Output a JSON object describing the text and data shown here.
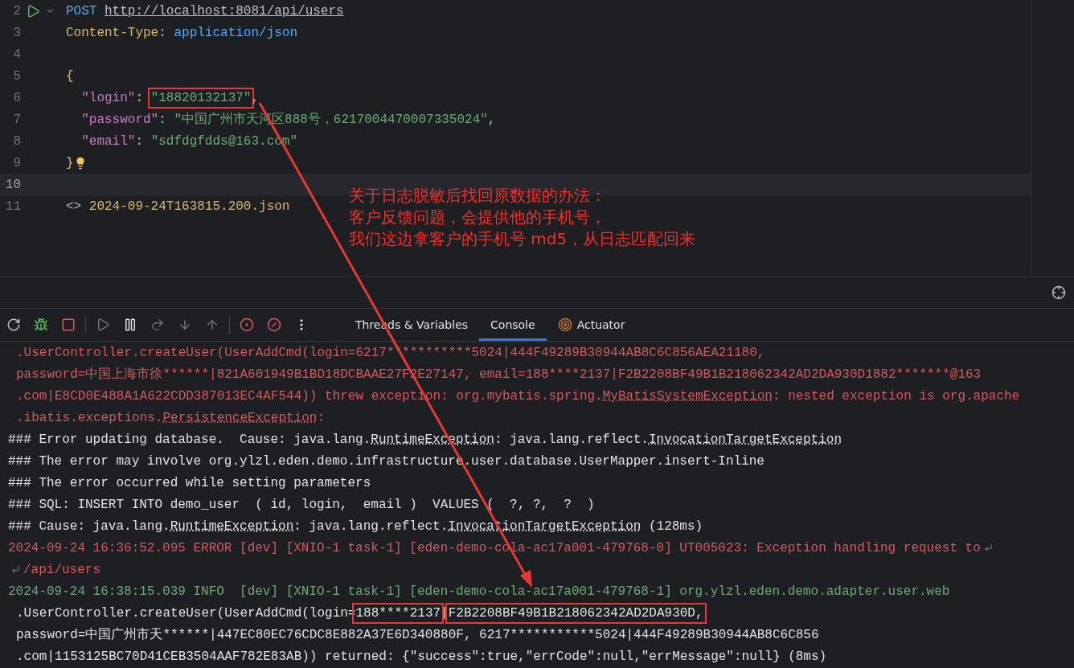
{
  "editor": {
    "lines": [
      {
        "number": "2",
        "runnable": true,
        "segments": [
          {
            "text": "POST ",
            "kind": "keyword"
          },
          {
            "text": "http://localhost:8081/api/users",
            "kind": "url"
          }
        ]
      },
      {
        "number": "3",
        "segments": [
          {
            "text": "Content-Type",
            "kind": "header"
          },
          {
            "text": ": ",
            "kind": "punct"
          },
          {
            "text": "application/json",
            "kind": "keyword"
          }
        ]
      },
      {
        "number": "4"
      },
      {
        "number": "5",
        "segments": [
          {
            "text": "{",
            "kind": "brace"
          }
        ]
      },
      {
        "number": "6",
        "segments": [
          {
            "text": "  \"login\"",
            "kind": "key"
          },
          {
            "text": ": ",
            "kind": "punct"
          },
          {
            "text": "\"18820132137\"",
            "kind": "string",
            "highlight": true
          },
          {
            "text": ",",
            "kind": "punct"
          }
        ]
      },
      {
        "number": "7",
        "segments": [
          {
            "text": "  \"password\"",
            "kind": "key"
          },
          {
            "text": ": ",
            "kind": "punct"
          },
          {
            "text": "\"中国广州市天河区888号，6217004470007335024\"",
            "kind": "string"
          },
          {
            "text": ",",
            "kind": "punct"
          }
        ]
      },
      {
        "number": "8",
        "segments": [
          {
            "text": "  \"email\"",
            "kind": "key"
          },
          {
            "text": ": ",
            "kind": "punct"
          },
          {
            "text": "\"sdfdgfdds@163.com\"",
            "kind": "string"
          }
        ]
      },
      {
        "number": "9",
        "hint": true,
        "segments": [
          {
            "text": "}",
            "kind": "brace"
          }
        ]
      },
      {
        "number": "10",
        "current": true
      },
      {
        "number": "11",
        "segments": [
          {
            "text": "<>",
            "kind": "punct"
          },
          {
            "text": " 2024-09-24T163815.200.json",
            "kind": "header"
          }
        ]
      }
    ]
  },
  "annotation": {
    "lines": [
      "关于日志脱敏后找回原数据的办法：",
      "客户反馈问题，会提供他的手机号，",
      "我们这边拿客户的手机号 md5，从日志匹配回来"
    ]
  },
  "debugger": {
    "tabs": [
      {
        "label": "Threads & Variables",
        "selected": false
      },
      {
        "label": "Console",
        "selected": true
      },
      {
        "label": "Actuator",
        "selected": false
      }
    ]
  },
  "console": {
    "lines": [
      {
        "kind": "error",
        "continued": true,
        "segments": [
          {
            "text": ".UserController.createUser(UserAddCmd(login=6217***********5024|444F49289B30944AB8C6C856AEA21180,"
          }
        ]
      },
      {
        "kind": "error",
        "continued": true,
        "segments": [
          {
            "text": "password=中国上海市徐******|821A601949B1BD18DCBAAE27F2E27147, email=188****2137|F2B2208BF49B1B218062342AD2DA930D1882*******@163"
          }
        ]
      },
      {
        "kind": "error",
        "continued": true,
        "segments": [
          {
            "text": ".com|E8CD0E488A1A622CDD387013EC4AF544)) threw exception: org.mybatis.spring."
          },
          {
            "text": "MyBatisSystemException",
            "link": true
          },
          {
            "text": ": nested exception is org.apache"
          }
        ]
      },
      {
        "kind": "error",
        "continued": true,
        "segments": [
          {
            "text": ".ibatis.exceptions."
          },
          {
            "text": "PersistenceException",
            "link": true
          },
          {
            "text": ":"
          }
        ]
      },
      {
        "kind": "plain",
        "segments": [
          {
            "text": "### Error updating database.  Cause: java.lang."
          },
          {
            "text": "RuntimeException",
            "link": true
          },
          {
            "text": ": java.lang.reflect."
          },
          {
            "text": "InvocationTargetException",
            "link": true
          }
        ]
      },
      {
        "kind": "plain",
        "segments": [
          {
            "text": "### The error may involve org.ylzl.eden.demo.infrastructure.user.database.UserMapper.insert-Inline"
          }
        ]
      },
      {
        "kind": "plain",
        "segments": [
          {
            "text": "### The error occurred while setting parameters"
          }
        ]
      },
      {
        "kind": "plain",
        "segments": [
          {
            "text": "### SQL: INSERT INTO demo_user  ( id, login,  email )  VALUES (  ?, ?,  ?  )"
          }
        ]
      },
      {
        "kind": "plain",
        "segments": [
          {
            "text": "### Cause: java.lang."
          },
          {
            "text": "RuntimeException",
            "link": true
          },
          {
            "text": ": java.lang.reflect."
          },
          {
            "text": "InvocationTargetException",
            "link": true
          },
          {
            "text": " (128ms)"
          }
        ]
      },
      {
        "kind": "error",
        "wrap_end": true,
        "segments": [
          {
            "text": "2024-09-24 16:36:52.095 ERROR [dev] [XNIO-1 task-1] [eden-demo-cola-ac17a001-479768-0] UT005023: Exception handling request to"
          }
        ]
      },
      {
        "kind": "error",
        "wrap_start": true,
        "segments": [
          {
            "text": "/api/users"
          }
        ]
      },
      {
        "kind": "info",
        "segments": [
          {
            "text": "2024-09-24 16:38:15.039 INFO  [dev] [XNIO-1 task-1] [eden-demo-cola-ac17a001-479768-1] org.ylzl.eden.demo.adapter.user.web"
          }
        ]
      },
      {
        "kind": "plain",
        "continued": true,
        "segments": [
          {
            "text": ".UserController.createUser(UserAddCmd(login="
          },
          {
            "text": "188****2137",
            "highlight": true
          },
          {
            "text": "|"
          },
          {
            "text": "F2B2208BF49B1B218062342AD2DA930D,",
            "highlight": true
          }
        ]
      },
      {
        "kind": "plain",
        "continued": true,
        "segments": [
          {
            "text": "password=中国广州市天******|447EC80EC76CDC8E882A37E6D340880F, 6217***********5024|444F49289B30944AB8C6C856"
          }
        ]
      },
      {
        "kind": "plain",
        "continued": true,
        "segments": [
          {
            "text": ".com|1153125BC70D41CEB3504AAF782E83AB)) returned: {\"success\":true,\"errCode\":null,\"errMessage\":null} (8ms)"
          }
        ]
      }
    ]
  }
}
